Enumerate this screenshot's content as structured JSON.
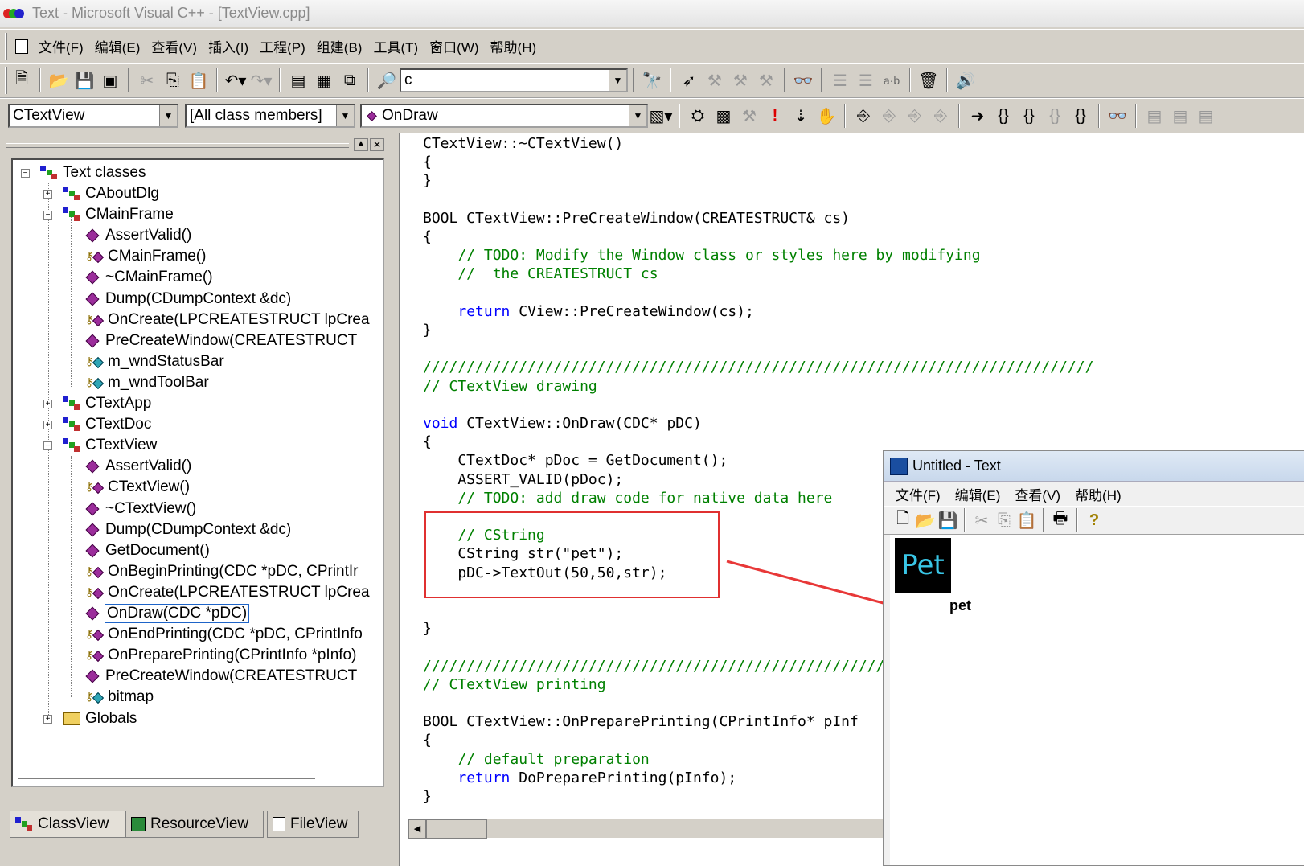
{
  "window": {
    "title": "Text - Microsoft Visual C++ - [TextView.cpp]"
  },
  "menubar": {
    "items": [
      "文件(F)",
      "编辑(E)",
      "查看(V)",
      "插入(I)",
      "工程(P)",
      "组建(B)",
      "工具(T)",
      "窗口(W)",
      "帮助(H)"
    ]
  },
  "toolbar": {
    "find_combo_value": "c",
    "class_combo_value": "CTextView",
    "filter_combo_value": "[All class members]",
    "member_combo_value": "OnDraw"
  },
  "tree": {
    "root": "Text classes",
    "nodes": [
      {
        "label": "CAboutDlg",
        "kind": "class",
        "level": 1,
        "expander": "+"
      },
      {
        "label": "CMainFrame",
        "kind": "class",
        "level": 1,
        "expander": "-"
      },
      {
        "label": "AssertValid()",
        "kind": "method",
        "level": 2
      },
      {
        "label": "CMainFrame()",
        "kind": "key",
        "level": 2
      },
      {
        "label": "~CMainFrame()",
        "kind": "method",
        "level": 2
      },
      {
        "label": "Dump(CDumpContext &dc)",
        "kind": "method",
        "level": 2
      },
      {
        "label": "OnCreate(LPCREATESTRUCT lpCrea",
        "kind": "key",
        "level": 2
      },
      {
        "label": "PreCreateWindow(CREATESTRUCT",
        "kind": "method",
        "level": 2
      },
      {
        "label": "m_wndStatusBar",
        "kind": "field",
        "level": 2
      },
      {
        "label": "m_wndToolBar",
        "kind": "field",
        "level": 2
      },
      {
        "label": "CTextApp",
        "kind": "class",
        "level": 1,
        "expander": "+"
      },
      {
        "label": "CTextDoc",
        "kind": "class",
        "level": 1,
        "expander": "+"
      },
      {
        "label": "CTextView",
        "kind": "class",
        "level": 1,
        "expander": "-"
      },
      {
        "label": "AssertValid()",
        "kind": "method",
        "level": 2
      },
      {
        "label": "CTextView()",
        "kind": "key",
        "level": 2
      },
      {
        "label": "~CTextView()",
        "kind": "method",
        "level": 2
      },
      {
        "label": "Dump(CDumpContext &dc)",
        "kind": "method",
        "level": 2
      },
      {
        "label": "GetDocument()",
        "kind": "method",
        "level": 2
      },
      {
        "label": "OnBeginPrinting(CDC *pDC, CPrintIr",
        "kind": "key",
        "level": 2
      },
      {
        "label": "OnCreate(LPCREATESTRUCT lpCrea",
        "kind": "key",
        "level": 2
      },
      {
        "label": "OnDraw(CDC *pDC)",
        "kind": "method",
        "level": 2,
        "selected": true
      },
      {
        "label": "OnEndPrinting(CDC *pDC, CPrintInfo",
        "kind": "key",
        "level": 2
      },
      {
        "label": "OnPreparePrinting(CPrintInfo *pInfo)",
        "kind": "key",
        "level": 2
      },
      {
        "label": "PreCreateWindow(CREATESTRUCT",
        "kind": "method",
        "level": 2
      },
      {
        "label": "bitmap",
        "kind": "field",
        "level": 2
      },
      {
        "label": "Globals",
        "kind": "folder",
        "level": 1,
        "expander": "+"
      }
    ]
  },
  "tabs": [
    "ClassView",
    "ResourceView",
    "FileView"
  ],
  "code": [
    "CTextView::~CTextView()",
    "{",
    "}",
    "",
    "BOOL CTextView::PreCreateWindow(CREATESTRUCT& cs)",
    "{",
    "    // TODO: Modify the Window class or styles here by modifying",
    "    //  the CREATESTRUCT cs",
    "",
    "    return CView::PreCreateWindow(cs);",
    "}",
    "",
    "/////////////////////////////////////////////////////////////////////////////",
    "// CTextView drawing",
    "",
    "void CTextView::OnDraw(CDC* pDC)",
    "{",
    "    CTextDoc* pDoc = GetDocument();",
    "    ASSERT_VALID(pDoc);",
    "    // TODO: add draw code for native data here",
    "",
    "    // CString",
    "    CString str(\"pet\");",
    "    pDC->TextOut(50,50,str);",
    "",
    "",
    "}",
    "",
    "/////////////////////////////////////////////////////",
    "// CTextView printing",
    "",
    "BOOL CTextView::OnPreparePrinting(CPrintInfo* pInf",
    "{",
    "    // default preparation",
    "    return DoPreparePrinting(pInfo);",
    "}"
  ],
  "output_window": {
    "title": "Untitled - Text",
    "menu": [
      "文件(F)",
      "编辑(E)",
      "查看(V)",
      "帮助(H)"
    ],
    "thumb_text": "Pet",
    "drawn_text": "pet"
  }
}
